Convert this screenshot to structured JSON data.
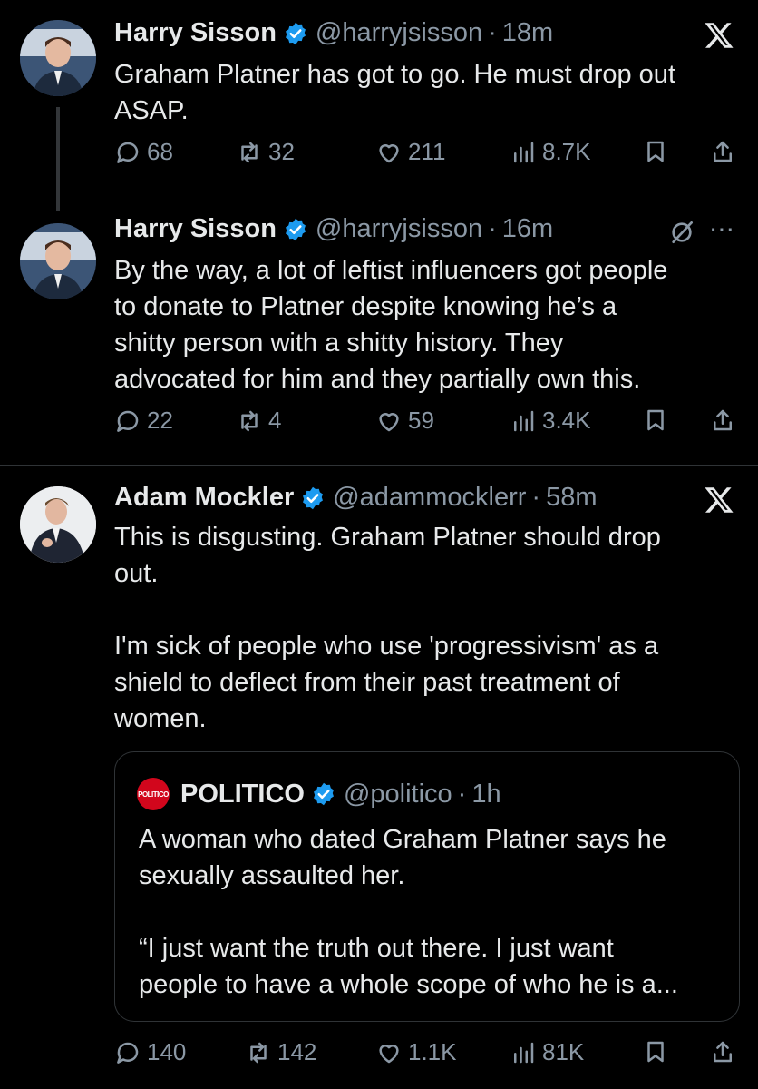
{
  "tweets": [
    {
      "name": "Harry Sisson",
      "handle": "@harryjsisson",
      "separator": "·",
      "time": "18m",
      "text": "Graham Platner has got to go. He must drop out\nASAP.",
      "corner_icon": "x-logo-icon",
      "stats": {
        "replies": "68",
        "reposts": "32",
        "likes": "211",
        "views": "8.7K"
      }
    },
    {
      "name": "Harry Sisson",
      "handle": "@harryjsisson",
      "separator": "·",
      "time": "16m",
      "text": "By the way, a lot of leftist influencers got people\nto donate to Platner despite knowing he’s a\nshitty person with a shitty history. They\nadvocated for him and they partially own this.",
      "corner_icon": "grok-icon",
      "stats": {
        "replies": "22",
        "reposts": "4",
        "likes": "59",
        "views": "3.4K"
      }
    },
    {
      "name": "Adam Mockler",
      "handle": "@adammocklerr",
      "separator": "·",
      "time": "58m",
      "text": "This is disgusting. Graham Platner should drop\nout.\n\nI'm sick of people who use 'progressivism' as a\nshield to deflect from their past treatment of\nwomen.",
      "corner_icon": "x-logo-icon",
      "quote": {
        "logo_text": "POLITICO",
        "name": "POLITICO",
        "handle": "@politico",
        "separator": "·",
        "time": "1h",
        "text": "A woman who dated Graham Platner says he\nsexually assaulted her.\n\n“I just want the truth out there. I just want\npeople to have a whole scope of who he is a..."
      },
      "stats": {
        "replies": "140",
        "reposts": "142",
        "likes": "1.1K",
        "views": "81K"
      }
    }
  ],
  "colors": {
    "background": "#000000",
    "text": "#e7e9ea",
    "muted": "#8b98a5",
    "verified": "#1d9bf0",
    "politico": "#d2061c"
  }
}
